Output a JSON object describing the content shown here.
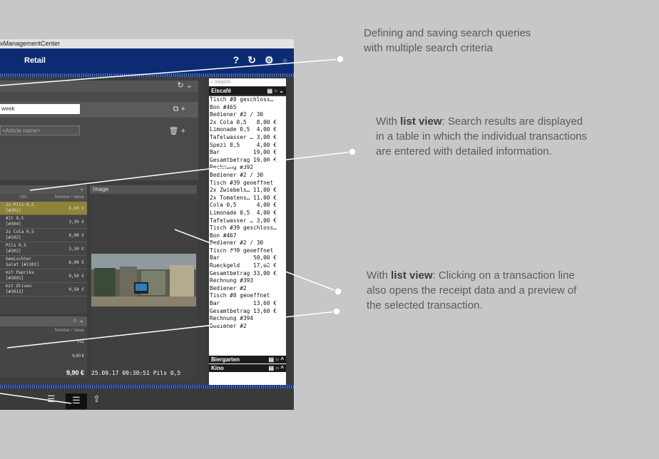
{
  "window": {
    "title": "xManagementCenter"
  },
  "header": {
    "title": "Retail",
    "icons": [
      "help-icon",
      "refresh-icon",
      "gear-icon",
      "user-icon"
    ]
  },
  "left_panel": {
    "query_value": "week",
    "article_placeholder": "<Article name>"
  },
  "table": {
    "columns": [
      "Info",
      "Number / Value"
    ],
    "rows": [
      {
        "info": "2x Pils 0,5\n[#302]",
        "value": "6,60 €",
        "selected": true
      },
      {
        "info": "Alt 0,5\n[#304]",
        "value": "3,30 €"
      },
      {
        "info": "2x Cola 0,5\n[#102]",
        "value": "8,00 €"
      },
      {
        "info": "Pils 0,5\n[#302]",
        "value": "3,30 €"
      },
      {
        "info": "Gemischter\nSalat [#1301]",
        "value": "6,00 €"
      },
      {
        "info": "mit Paprika\n[#3001]",
        "value": "0,50 €"
      },
      {
        "info": "mit Oliven\n[#3013]",
        "value": "0,50 €"
      }
    ]
  },
  "image_panel": {
    "label": "Image",
    "footer": "25.09.17 09:30:51 Pils 0,5"
  },
  "summary": {
    "column": "Number / Value",
    "rows": [
      "#11",
      "6,60 €"
    ],
    "total": "9,90 €"
  },
  "right_column": {
    "search_placeholder": "Search",
    "groups": [
      "Eiscafé",
      "Biergarten",
      "Kino"
    ],
    "receipt_lines": [
      "Tisch #8 geschloss…",
      "Bon #465",
      "Bediener #2 / 30",
      "2x Cola 0,5   8,00 €",
      "Limonade 0,5  4,00 €",
      "Tafelwasser … 3,00 €",
      "Spezi 0,5     4,00 €",
      "Bar          19,00 €",
      "Gesamtbetrag 19,00 €",
      "Rechnung #392",
      "Bediener #2 / 30",
      "Tisch #39 geoeffnet",
      "2x Zwiebels… 11,00 €",
      "2x Tomatens… 11,00 €",
      "Cola 0,5      4,00 €",
      "Limonade 0,5  4,00 €",
      "Tafelwasser … 3,00 €",
      "Tisch #39 geschloss…",
      "Bon #467",
      "Bediener #2 / 30",
      "Tisch #39 geoeffnet",
      "Bar          50,00 €",
      "Rueckgeld    17,00 €",
      "Gesamtbetrag 33,00 €",
      "Rechnung #393",
      "Bediener #2",
      "Tisch #8 geoeffnet",
      "Bar          13,60 €",
      "Gesamtbetrag 13,60 €",
      "Rechnung #394",
      "Bediener #2"
    ]
  },
  "annotations": {
    "a1": "Defining and saving search queries with multiple search criteria",
    "a2_bold": "list view",
    "a2_pre": "With ",
    "a2_post": ": Search results are displayed in a table in which the individual transactions are entered with detailed information.",
    "a3_bold": "list view",
    "a3_pre": "With ",
    "a3_post": ": Clicking on a transaction line also opens the receipt data and a preview of the selected transaction."
  }
}
